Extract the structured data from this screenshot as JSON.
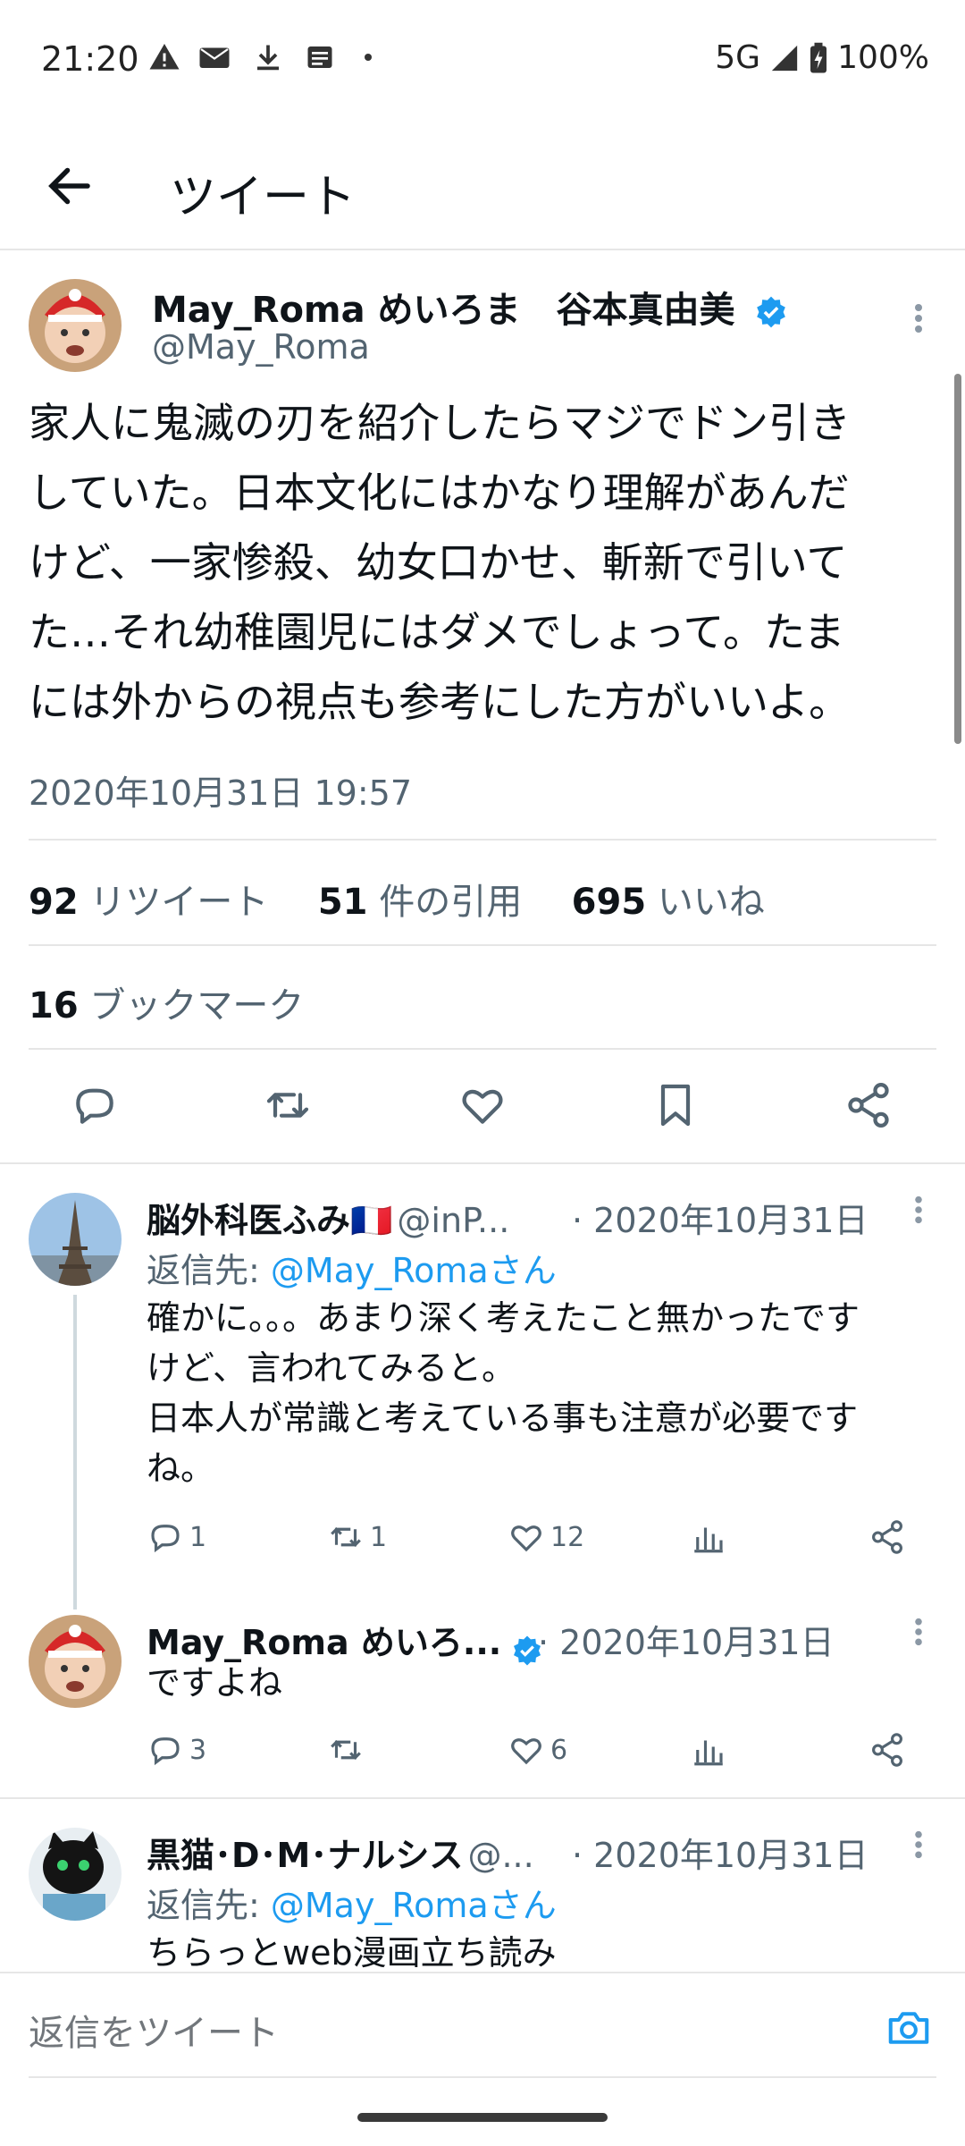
{
  "status_bar": {
    "time": "21:20",
    "network": "5G",
    "battery": "100%",
    "icons": [
      "warning-icon",
      "cau-mail-icon",
      "download-icon",
      "news-icon",
      "dot-icon"
    ]
  },
  "header": {
    "title": "ツイート"
  },
  "tweet": {
    "display_name": "May_Roma めいろま　谷本真由美",
    "handle": "@May_Roma",
    "verified": true,
    "text_lines": [
      "家人に鬼滅の刃を紹介したらマジでドン引き",
      "していた。日本文化にはかなり理解があんだ",
      "けど、一家惨殺、幼女口かせ、斬新で引いて",
      "た…それ幼稚園児にはダメでしょって。たま",
      "には外からの視点も参考にした方がいいよ。"
    ],
    "timestamp": "2020年10月31日 19:57",
    "stats": {
      "retweets": "92",
      "retweets_label": "リツイート",
      "quotes": "51",
      "quotes_label": "件の引用",
      "likes": "695",
      "likes_label": "いいね"
    },
    "bookmarks": "16",
    "bookmarks_label": "ブックマーク"
  },
  "replies": [
    {
      "display_name": "脳外科医ふみ🇫🇷",
      "handle": "@inP...",
      "date": "· 2020年10月31日",
      "reply_to_prefix": "返信先: ",
      "reply_to_user": "@May_Romaさん",
      "text_lines": [
        "確かに。。。あまり深く考えたこと無かったです",
        "けど、言われてみると。",
        "日本人が常識と考えている事も注意が必要です",
        "ね。"
      ],
      "replies": "1",
      "retweets": "1",
      "likes": "12"
    },
    {
      "display_name": "May_Roma めいろ...",
      "date": "· 2020年10月31日",
      "verified": true,
      "text_lines": [
        "ですよね"
      ],
      "replies": "3",
      "retweets": "",
      "likes": "6"
    },
    {
      "display_name": "黒猫･D･M･ナルシス",
      "handle": "@...",
      "date": "· 2020年10月31日",
      "reply_to_prefix": "返信先: ",
      "reply_to_user": "@May_Romaさん",
      "text_lines": [
        "ちらっとweb漫画立ち読み"
      ]
    }
  ],
  "composer": {
    "placeholder": "返信をツイート"
  },
  "colors": {
    "accent": "#1d9bf0",
    "text": "#0f1419",
    "muted": "#536471"
  }
}
